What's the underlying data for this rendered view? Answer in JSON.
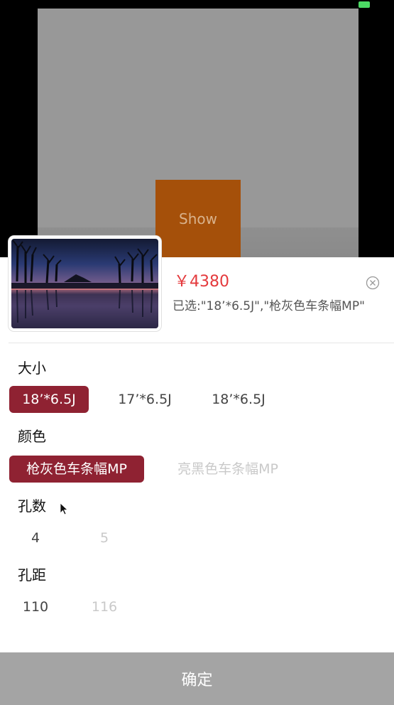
{
  "background": {
    "show_button_label": "Show"
  },
  "product": {
    "price": "￥4380",
    "selected_text": "已选:\"18’*6.5J\",\"枪灰色车条幅MP\""
  },
  "sections": [
    {
      "title": "大小",
      "options": [
        "18’*6.5J",
        "17’*6.5J",
        "18’*6.5J"
      ]
    },
    {
      "title": "颜色",
      "options": [
        "枪灰色车条幅MP",
        "亮黑色车条幅MP"
      ]
    },
    {
      "title": "孔数",
      "options": [
        "4",
        "5"
      ]
    },
    {
      "title": "孔距",
      "options": [
        "110",
        "116"
      ]
    }
  ],
  "footer": {
    "confirm_label": "确定"
  },
  "colors": {
    "accent": "#8f2232",
    "price": "#e4393c",
    "disabled": "#c9c9c9",
    "confirm_bg": "#a4a4a4",
    "show_button_bg": "#a5500a"
  },
  "icons": [
    "close-icon",
    "cursor-icon",
    "battery-icon"
  ]
}
